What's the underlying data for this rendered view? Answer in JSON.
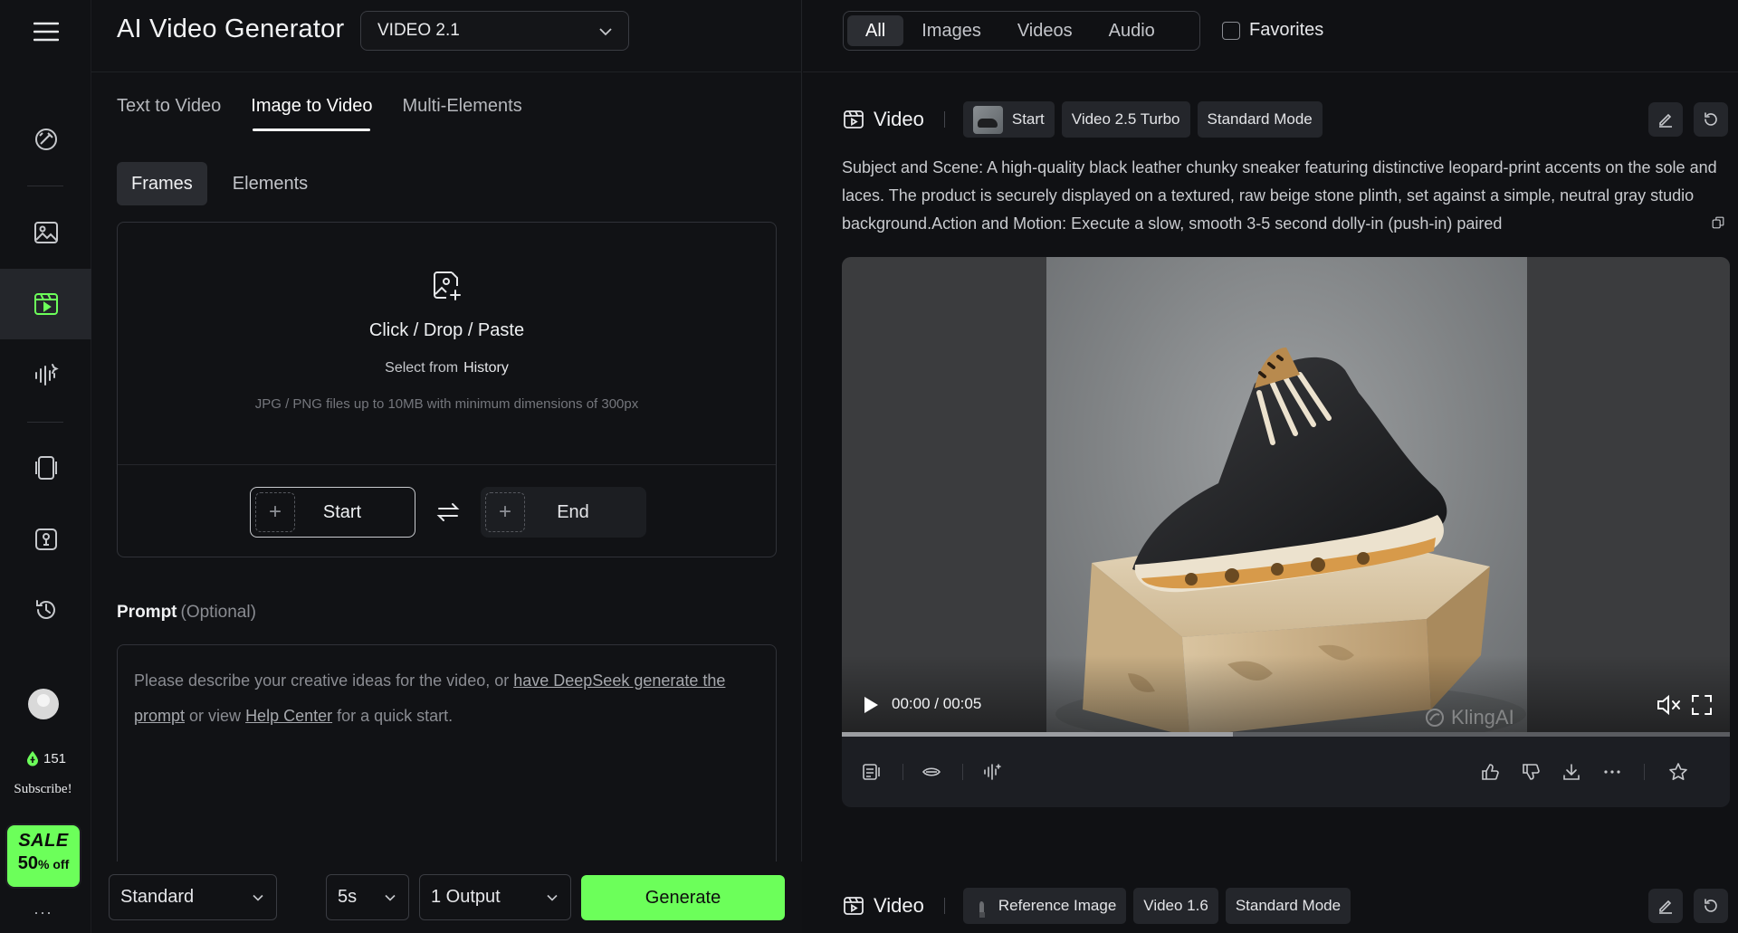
{
  "sidebar": {
    "credits": "151",
    "subscribe_label": "Subscribe!",
    "sale_badge": "SALE",
    "sale_amount": "50",
    "sale_suffix": "% off",
    "more_label": "···"
  },
  "header": {
    "title": "AI Video Generator",
    "model_value": "VIDEO 2.1"
  },
  "tabs": [
    {
      "label": "Text to Video"
    },
    {
      "label": "Image to Video"
    },
    {
      "label": "Multi-Elements"
    }
  ],
  "subtabs": [
    {
      "label": "Frames"
    },
    {
      "label": "Elements"
    }
  ],
  "upload": {
    "title": "Click / Drop / Paste",
    "select_from": "Select from",
    "history": "History",
    "hint": "JPG / PNG files up to 10MB with minimum dimensions of 300px",
    "start_label": "Start",
    "end_label": "End"
  },
  "prompt": {
    "label": "Prompt",
    "optional": "(Optional)",
    "p1": "Please describe your creative ideas for the video, or ",
    "link1": "have DeepSeek generate the prompt",
    "p2": " or view ",
    "link2": "Help Center",
    "p3": " for a quick start."
  },
  "footer": {
    "mode_value": "Standard",
    "duration_value": "5s",
    "outputs_value": "1 Output",
    "generate_label": "Generate"
  },
  "filters": {
    "items": [
      {
        "label": "All"
      },
      {
        "label": "Images"
      },
      {
        "label": "Videos"
      },
      {
        "label": "Audio"
      }
    ],
    "favorites_label": "Favorites"
  },
  "card1": {
    "type_label": "Video",
    "chips": [
      "Start",
      "Video 2.5 Turbo",
      "Standard Mode"
    ],
    "description": "Subject and Scene: A high-quality black leather chunky sneaker featuring distinctive leopard-print accents on the sole and laces. The product is securely displayed on a textured, raw beige stone plinth, set against a simple, neutral gray studio background.Action and Motion: Execute a slow, smooth 3-5 second dolly-in (push-in) paired",
    "time_current": "00:00",
    "time_sep": "/",
    "time_total": "00:05",
    "watermark": "KlingAI",
    "progress": 0.44
  },
  "card2": {
    "type_label": "Video",
    "chips": [
      "Reference Image",
      "Video 1.6",
      "Standard Mode"
    ]
  },
  "colors": {
    "accent": "#6cff5a",
    "background": "#101114"
  }
}
